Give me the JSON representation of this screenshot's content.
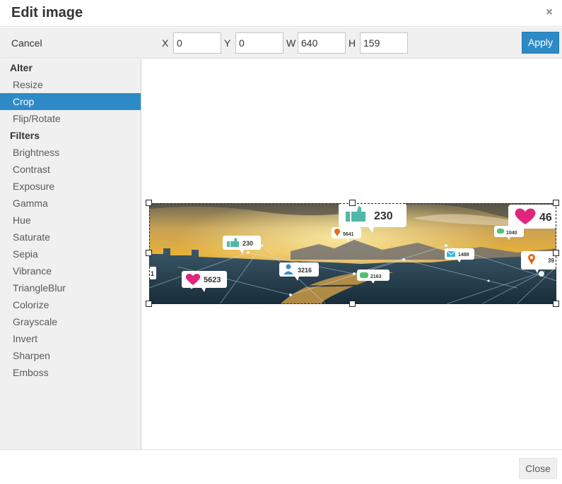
{
  "dialog": {
    "title": "Edit image",
    "close_icon": "×"
  },
  "toolbar": {
    "cancel_label": "Cancel",
    "x_label": "X",
    "x_value": "0",
    "y_label": "Y",
    "y_value": "0",
    "w_label": "W",
    "w_value": "640",
    "h_label": "H",
    "h_value": "159",
    "apply_label": "Apply"
  },
  "sidebar": {
    "alter_heading": "Alter",
    "alter_items": [
      {
        "label": "Resize"
      },
      {
        "label": "Crop"
      },
      {
        "label": "Flip/Rotate"
      }
    ],
    "filters_heading": "Filters",
    "filter_items": [
      {
        "label": "Brightness"
      },
      {
        "label": "Contrast"
      },
      {
        "label": "Exposure"
      },
      {
        "label": "Gamma"
      },
      {
        "label": "Hue"
      },
      {
        "label": "Saturate"
      },
      {
        "label": "Sepia"
      },
      {
        "label": "Vibrance"
      },
      {
        "label": "TriangleBlur"
      },
      {
        "label": "Colorize"
      },
      {
        "label": "Grayscale"
      },
      {
        "label": "Invert"
      },
      {
        "label": "Sharpen"
      },
      {
        "label": "Emboss"
      }
    ],
    "selected": "Crop"
  },
  "image": {
    "badges": {
      "like_big": "230",
      "heart_right": "46",
      "like_small": "230",
      "pin_small": "5641",
      "chat_right": "1040",
      "mail": "1488",
      "pin_right": "39",
      "user": "3216",
      "heart_left": "5623",
      "chat_mid": "2163",
      "edge_left": "1"
    }
  },
  "footer": {
    "close_label": "Close"
  },
  "colors": {
    "accent": "#2d8ac7",
    "sidebar_bg": "#f0f0f0",
    "heart": "#e0267c",
    "like": "#4fb8a6",
    "pin": "#e46a1c",
    "user": "#3c8dc8"
  }
}
